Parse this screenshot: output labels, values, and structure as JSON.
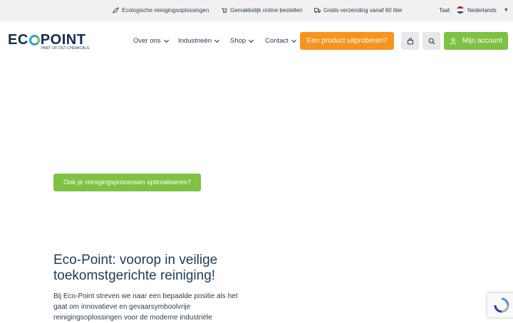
{
  "topbar": {
    "usps": [
      {
        "icon": "leaf-icon",
        "text": "Ecologische reinigingsoplossingen"
      },
      {
        "icon": "cart-icon",
        "text": "Gemakkelijk online bestellen"
      },
      {
        "icon": "truck-icon",
        "text": "Gratis verzending vanaf 60 liter"
      }
    ],
    "language_label": "Taal:",
    "language_value": "Nederlands"
  },
  "header": {
    "logo_text_pre": "EC",
    "logo_text_post": "POINT",
    "logo_sub": "PART OF DST-CHEMICALS",
    "nav": [
      "Over ons",
      "Industrieën",
      "Shop",
      "Contact"
    ],
    "try_product_label": "Een product uitproberen?",
    "account_label": "Mijn account"
  },
  "hero": {
    "cta_label": "Ook je reinigingsprocessen optimaliseren?"
  },
  "intro": {
    "title": "Eco-Point: voorop in veilige toekomstgerichte reiniging!",
    "text": "Bij Eco-Point streven we naar een bepaalde positie als het gaat om innovatieve en gevaarsymboolvrije reinigingsoplossingen voor de moderne industriële"
  },
  "colors": {
    "navy": "#1f3b57",
    "green": "#7dc242",
    "orange": "#f7941d",
    "topbar_bg": "#f1f1f1"
  }
}
